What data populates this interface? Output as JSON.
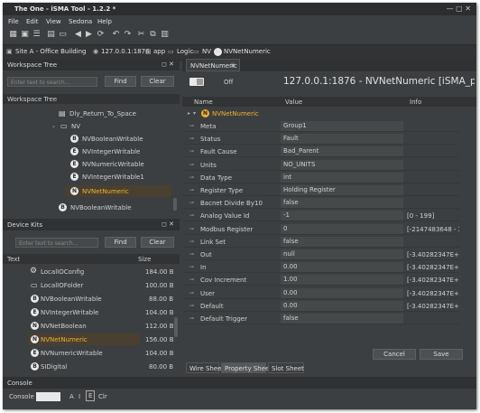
{
  "window": {
    "title": "The One - iSMA Tool - 1.2.2 *"
  },
  "menu": [
    "File",
    "Edit",
    "View",
    "Sedona",
    "Help"
  ],
  "breadcrumb": [
    "Site A - Office Building",
    "127.0.0.1:1876",
    "app",
    "Logic",
    "NV",
    "NVNetNumeric"
  ],
  "workspace": {
    "title": "Workspace Tree",
    "search_placeholder": "Enter text to search...",
    "find": "Find",
    "clear": "Clear",
    "tree_title": "Workspace Tree",
    "items": [
      {
        "label": "Dly_Return_To_Space",
        "icon": "doc"
      },
      {
        "label": "NV",
        "icon": "folder"
      },
      {
        "label": "NVBooleanWritable",
        "icon": "B"
      },
      {
        "label": "NVIntegerWritable",
        "icon": "E"
      },
      {
        "label": "NVNumericWritable",
        "icon": "E"
      },
      {
        "label": "NVIntegerWritable1",
        "icon": "E"
      },
      {
        "label": "NVNetNumeric",
        "icon": "N"
      },
      {
        "label": "NVBooleanWritable",
        "icon": "B"
      }
    ]
  },
  "kits": {
    "title": "Device Kits",
    "search_placeholder": "Enter text to search...",
    "find": "Find",
    "clear": "Clear",
    "col_text": "Text",
    "col_size": "Size",
    "items": [
      {
        "label": "LocalIOConfig",
        "size": "184.00 B",
        "icon": "gear"
      },
      {
        "label": "LocalIOFolder",
        "size": "100.00 B",
        "icon": "folder"
      },
      {
        "label": "NVBooleanWritable",
        "size": "88.00 B",
        "icon": "B"
      },
      {
        "label": "NVIntegerWritable",
        "size": "104.00 B",
        "icon": "E"
      },
      {
        "label": "NVNetBoolean",
        "size": "112.00 B",
        "icon": "N"
      },
      {
        "label": "NVNetNumeric",
        "size": "156.00 B",
        "icon": "N"
      },
      {
        "label": "NVNumericWritable",
        "size": "104.00 B",
        "icon": "E"
      },
      {
        "label": "SIDigital",
        "size": "80.00 B",
        "icon": "B"
      }
    ]
  },
  "editor": {
    "tab": "NVNetNumeric",
    "off": "Off",
    "heading": "127.0.0.1:1876 - NVNetNumeric [iSMA_platF",
    "col_name": "Name",
    "col_value": "Value",
    "col_info": "Info",
    "root": "NVNetNumeric",
    "props": [
      {
        "name": "Meta",
        "value": "Group1",
        "info": ""
      },
      {
        "name": "Status",
        "value": "Fault",
        "info": ""
      },
      {
        "name": "Fault Cause",
        "value": "Bad_Parent",
        "info": ""
      },
      {
        "name": "Units",
        "value": "NO_UNITS",
        "info": ""
      },
      {
        "name": "Data Type",
        "value": "int",
        "info": ""
      },
      {
        "name": "Register Type",
        "value": "Holding Register",
        "info": ""
      },
      {
        "name": "Bacnet Divide By10",
        "value": "false",
        "info": ""
      },
      {
        "name": "Analog Value Id",
        "value": "-1",
        "info": "[0 - 199]"
      },
      {
        "name": "Modbus Register",
        "value": "0",
        "info": "[-2147483648 - 214"
      },
      {
        "name": "Link Set",
        "value": "false",
        "info": ""
      },
      {
        "name": "Out",
        "value": "null",
        "info": "[-3.40282347E+38 -"
      },
      {
        "name": "In",
        "value": "0.00",
        "info": "[-3.40282347E+38 -"
      },
      {
        "name": "Cov Increment",
        "value": "1.00",
        "info": "[-3.40282347E+38 -"
      },
      {
        "name": "User",
        "value": "0.00",
        "info": "[-3.40282347E+38 -"
      },
      {
        "name": "Default",
        "value": "0.00",
        "info": "[-3.40282347E+38 -"
      },
      {
        "name": "Default Trigger",
        "value": "false",
        "info": ""
      }
    ],
    "cancel": "Cancel",
    "save": "Save",
    "tabs": [
      "Wire Sheet",
      "Property Sheet",
      "Slot Sheet"
    ]
  },
  "console": {
    "title": "Console",
    "label": "Console",
    "toggles": [
      "A",
      "I",
      "E",
      "Clr"
    ]
  }
}
